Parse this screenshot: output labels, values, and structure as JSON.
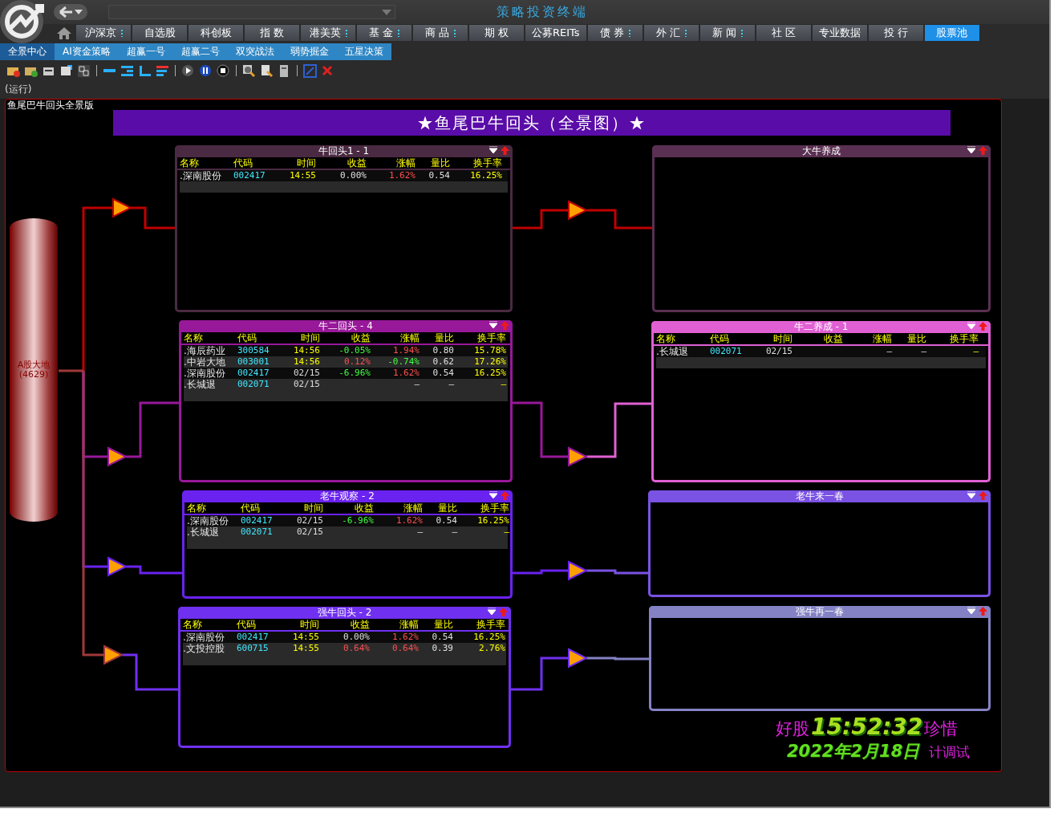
{
  "window": {
    "title": "策略投资终端"
  },
  "main_tabs": [
    {
      "label": "沪深京",
      "has_menu": true,
      "selected": false
    },
    {
      "label": "自选股",
      "has_menu": false,
      "selected": false
    },
    {
      "label": "科创板",
      "has_menu": false,
      "selected": false
    },
    {
      "label": "指 数",
      "has_menu": false,
      "selected": false
    },
    {
      "label": "港美英",
      "has_menu": true,
      "selected": false
    },
    {
      "label": "基 金",
      "has_menu": true,
      "selected": false
    },
    {
      "label": "商 品",
      "has_menu": true,
      "selected": false
    },
    {
      "label": "期 权",
      "has_menu": false,
      "selected": false
    },
    {
      "label": "公募REITs",
      "has_menu": false,
      "selected": false
    },
    {
      "label": "债 券",
      "has_menu": true,
      "selected": false
    },
    {
      "label": "外 汇",
      "has_menu": true,
      "selected": false
    },
    {
      "label": "新 闻",
      "has_menu": true,
      "selected": false
    },
    {
      "label": "社 区",
      "has_menu": false,
      "selected": false
    },
    {
      "label": "专业数据",
      "has_menu": false,
      "selected": false
    },
    {
      "label": "投 行",
      "has_menu": false,
      "selected": false
    },
    {
      "label": "股票池",
      "has_menu": false,
      "selected": true
    }
  ],
  "sub_tabs": [
    {
      "label": "全景中心",
      "selected": true
    },
    {
      "label": "AI资金策略",
      "selected": false
    },
    {
      "label": "超赢一号",
      "selected": false
    },
    {
      "label": "超赢二号",
      "selected": false
    },
    {
      "label": "双突战法",
      "selected": false
    },
    {
      "label": "弱势掘金",
      "selected": false
    },
    {
      "label": "五星决策",
      "selected": false
    }
  ],
  "status": "(运行)",
  "frame_title": "鱼尾巴牛回头全景版",
  "banner": "★鱼尾巴牛回头（全景图）★",
  "source": {
    "label": "A股大地",
    "count": "(4629)"
  },
  "panels": [
    {
      "title": "牛回头1 - 1",
      "color": "#4a2a42",
      "columns": [
        "名称",
        "代码",
        "时间",
        "收益",
        "涨幅",
        "量比",
        "换手率"
      ],
      "rows": [
        {
          "name": ".深南股份",
          "code": "002417",
          "time": "14:55",
          "today": true,
          "yield": {
            "text": "0.00%",
            "up": false,
            "down": false
          },
          "change": {
            "text": "1.62%",
            "up": true,
            "down": false
          },
          "ratio": "0.54",
          "turnover": "16.25%"
        }
      ]
    },
    {
      "title": "大牛养成",
      "color": "#5a3052"
    },
    {
      "title": "牛二回头 - 4",
      "color": "#98189a",
      "columns": [
        "名称",
        "代码",
        "时间",
        "收益",
        "涨幅",
        "量比",
        "换手率"
      ],
      "rows": [
        {
          "name": ".海辰药业",
          "code": "300584",
          "time": "14:56",
          "today": true,
          "yield": {
            "text": "-0.05%",
            "up": false,
            "down": true
          },
          "change": {
            "text": "1.94%",
            "up": true,
            "down": false
          },
          "ratio": "0.80",
          "turnover": "15.78%"
        },
        {
          "name": ".中岩大地",
          "code": "003001",
          "time": "14:56",
          "today": true,
          "yield": {
            "text": "0.12%",
            "up": true,
            "down": false
          },
          "change": {
            "text": "-0.74%",
            "up": false,
            "down": true
          },
          "ratio": "0.62",
          "turnover": "17.26%"
        },
        {
          "name": ".深南股份",
          "code": "002417",
          "time": "02/15",
          "today": false,
          "yield": {
            "text": "-6.96%",
            "up": false,
            "down": true
          },
          "change": {
            "text": "1.62%",
            "up": true,
            "down": false
          },
          "ratio": "0.54",
          "turnover": "16.25%"
        },
        {
          "name": ".长城退",
          "code": "002071",
          "time": "02/15",
          "today": false,
          "change": {
            "text": "—",
            "up": false,
            "down": false
          },
          "ratio": "—",
          "turnover": "—"
        }
      ]
    },
    {
      "title": "牛二养成 - 1",
      "color": "#e060d4",
      "columns": [
        "名称",
        "代码",
        "时间",
        "收益",
        "涨幅",
        "量比",
        "换手率"
      ],
      "rows": [
        {
          "name": ".长城退",
          "code": "002071",
          "time": "02/15",
          "today": false,
          "change": {
            "text": "—",
            "up": false,
            "down": false
          },
          "ratio": "—",
          "turnover": "—"
        }
      ]
    },
    {
      "title": "老牛观察 - 2",
      "color": "#6a22f0",
      "columns": [
        "名称",
        "代码",
        "时间",
        "收益",
        "涨幅",
        "量比",
        "换手率"
      ],
      "rows": [
        {
          "name": ".深南股份",
          "code": "002417",
          "time": "02/15",
          "today": false,
          "yield": {
            "text": "-6.96%",
            "up": false,
            "down": true
          },
          "change": {
            "text": "1.62%",
            "up": true,
            "down": false
          },
          "ratio": "0.54",
          "turnover": "16.25%"
        },
        {
          "name": ".长城退",
          "code": "002071",
          "time": "02/15",
          "today": false,
          "change": {
            "text": "—",
            "up": false,
            "down": false
          },
          "ratio": "—",
          "turnover": "—"
        }
      ]
    },
    {
      "title": "老牛来一春",
      "color": "#7a52e4"
    },
    {
      "title": "强牛回头 - 2",
      "color": "#7030f0",
      "columns": [
        "名称",
        "代码",
        "时间",
        "收益",
        "涨幅",
        "量比",
        "换手率"
      ],
      "rows": [
        {
          "name": ".深南股份",
          "code": "002417",
          "time": "14:55",
          "today": true,
          "yield": {
            "text": "0.00%",
            "up": false,
            "down": false
          },
          "change": {
            "text": "1.62%",
            "up": true,
            "down": false
          },
          "ratio": "0.54",
          "turnover": "16.25%"
        },
        {
          "name": ".文投控股",
          "code": "600715",
          "time": "14:55",
          "today": true,
          "yield": {
            "text": "0.64%",
            "up": true,
            "down": false
          },
          "change": {
            "text": "0.64%",
            "up": true,
            "down": false
          },
          "ratio": "0.39",
          "turnover": "2.76%"
        }
      ]
    },
    {
      "title": "强牛再一春",
      "color": "#8482c4"
    }
  ],
  "clock": {
    "motto_start": "好股",
    "time": "15:52:32",
    "motto_end": "珍惜",
    "date": "2022年2月18日",
    "note": "计调试"
  }
}
